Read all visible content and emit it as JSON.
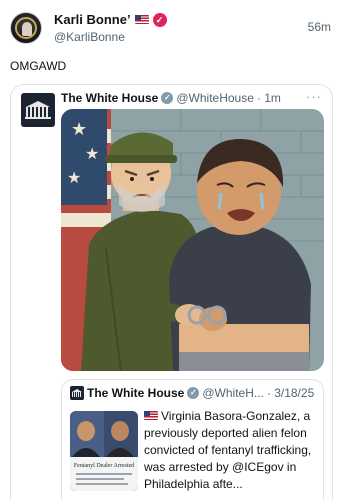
{
  "post": {
    "author_name": "Karli Bonne’",
    "handle": "@KarliBonne",
    "time": "56m",
    "text": "OMGAWD"
  },
  "quote": {
    "author_name": "The White House",
    "handle": "@WhiteHouse",
    "time": "· 1m",
    "more": "···"
  },
  "nested_quote": {
    "author_name": "The White House",
    "handle": "@WhiteH...",
    "date": "· 3/18/25",
    "text": "Virginia Basora-Gonzalez, a previously deported alien felon convicted of fentanyl trafficking, was arrested by @ICEgov in Philadelphia afte...",
    "thumb_caption": "Fentanyl Dealer Arrested"
  },
  "icons": {
    "verified_badge": "verified-check-icon",
    "gov_badge": "government-check-icon",
    "flag": "us-flag-icon",
    "more": "more-dots-icon"
  },
  "colors": {
    "verified_pink": "#e0245e",
    "gov_gray": "#829aab",
    "secondary_text": "#536471",
    "border": "#dfe3e6"
  }
}
